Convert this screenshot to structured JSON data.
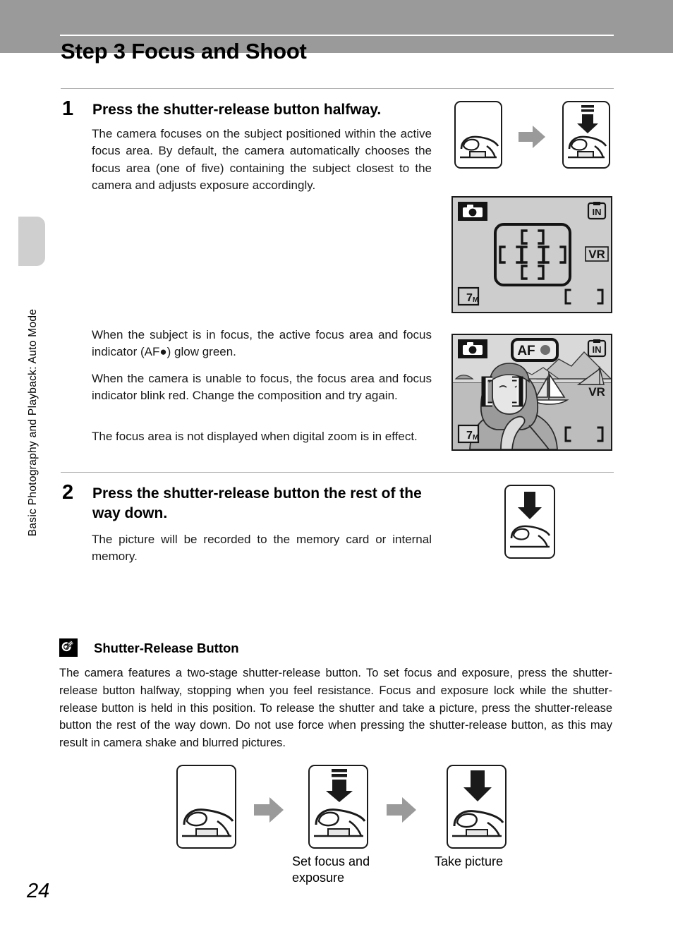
{
  "header": {
    "title": "Step 3 Focus and Shoot"
  },
  "sidebar": {
    "chapter_label": "Basic Photography and Playback: Auto Mode",
    "tab_color": "#cfcfcf"
  },
  "footer": {
    "page_number": "24"
  },
  "steps": [
    {
      "number": "1",
      "heading": "Press the shutter-release button halfway.",
      "body": "The camera focuses on the subject positioned within the active focus area. By default, the camera automatically chooses the focus area (one of five) containing the subject closest to the camera and adjusts exposure accordingly."
    },
    {
      "number": "2",
      "heading": "Press the shutter-release button the rest of the way down.",
      "body": "The picture will be recorded to the memory card or internal memory."
    }
  ],
  "focus_paragraphs": [
    "When the subject is in focus, the active focus area and focus indicator (AF●) glow green.",
    "When the camera is unable to focus, the focus area and focus indicator blink red. Change the composition and try again.",
    "The focus area is not displayed when digital zoom is in effect."
  ],
  "lcd_screens": [
    {
      "name": "focus-area-display",
      "mode_icon": "camera-icon",
      "memory_icon": "IN",
      "vr_icon": "VR",
      "resolution_icon": "7M",
      "focus_areas": 5,
      "scene": "none"
    },
    {
      "name": "focus-locked-display",
      "mode_icon": "camera-icon",
      "af_indicator": "AF",
      "memory_icon": "IN",
      "vr_icon": "VR",
      "resolution_icon": "7M",
      "scene": "portrait-with-sailboats"
    }
  ],
  "note": {
    "icon": "lightbulb-tip-icon",
    "title": "Shutter-Release Button",
    "body": "The camera features a two-stage shutter-release button. To set focus and exposure, press the shutter-release button halfway, stopping when you feel resistance. Focus and exposure lock while the shutter-release button is held in this position. To release the shutter and take a picture, press the shutter-release button the rest of the way down. Do not use force when pressing the shutter-release button, as this may result in camera shake and blurred pictures."
  },
  "sequence": {
    "captions": [
      {
        "text": ""
      },
      {
        "text": "Set focus and exposure"
      },
      {
        "text": "Take picture"
      }
    ],
    "arrow_color": "#9a9a9a"
  },
  "colors": {
    "header_band": "#9a9a9a",
    "lcd_background": "#cdcdcd",
    "rule": "#b0b0b0",
    "ink": "#1a1a1a"
  }
}
